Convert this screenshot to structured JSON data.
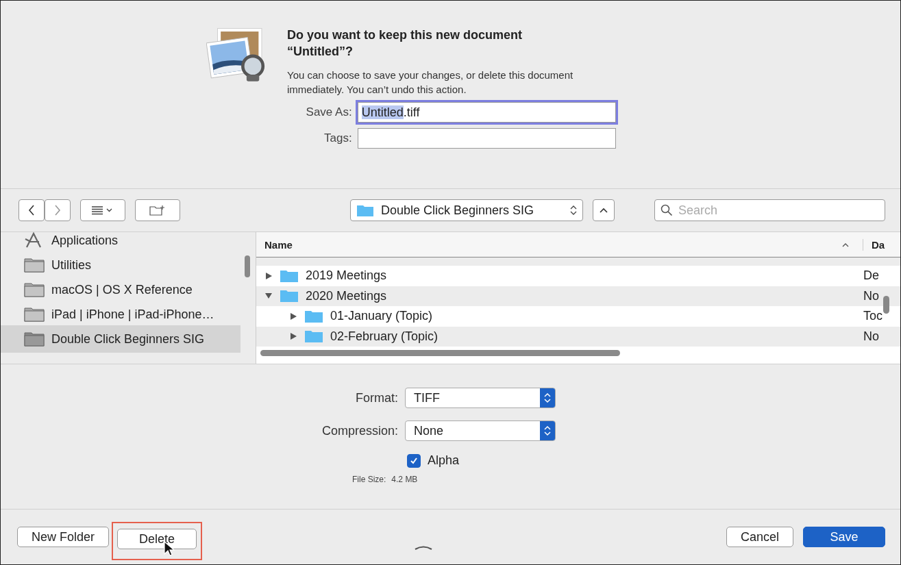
{
  "message": {
    "title": "Do you want to keep this new document “Untitled”?",
    "body": "You can choose to save your changes, or delete this document immediately. You can’t undo this action."
  },
  "save_as": {
    "label": "Save As:",
    "selected_text": "Untitled",
    "rest_text": ".tiff"
  },
  "tags": {
    "label": "Tags:"
  },
  "toolbar": {
    "location": "Double Click Beginners SIG",
    "search_placeholder": "Search"
  },
  "sidebar": {
    "items": [
      {
        "label": "Applications",
        "kind": "app",
        "selected": false
      },
      {
        "label": "Utilities",
        "kind": "folder",
        "selected": false
      },
      {
        "label": "macOS | OS X Reference",
        "kind": "folder",
        "selected": false
      },
      {
        "label": "iPad | iPhone | iPad-iPhone…",
        "kind": "folder",
        "selected": false
      },
      {
        "label": "Double Click Beginners SIG",
        "kind": "folder",
        "selected": true
      }
    ]
  },
  "browser": {
    "columns": [
      "Name",
      "Da"
    ],
    "rows": [
      {
        "name": "2019 Meetings",
        "date": "De",
        "expanded": false
      },
      {
        "name": "2020 Meetings",
        "date": "No",
        "expanded": true,
        "children": [
          {
            "name": "01-January (Topic)",
            "date": "Toc",
            "expanded": false
          },
          {
            "name": "02-February (Topic)",
            "date": "No",
            "expanded": false
          }
        ]
      }
    ]
  },
  "options": {
    "format_label": "Format:",
    "format": "TIFF",
    "compression_label": "Compression:",
    "compression": "None",
    "alpha_label": "Alpha",
    "alpha_checked": true,
    "file_size_label": "File Size:",
    "file_size": "4.2 MB"
  },
  "buttons": {
    "new_folder": "New Folder",
    "delete": "Delete",
    "cancel": "Cancel",
    "save": "Save"
  }
}
